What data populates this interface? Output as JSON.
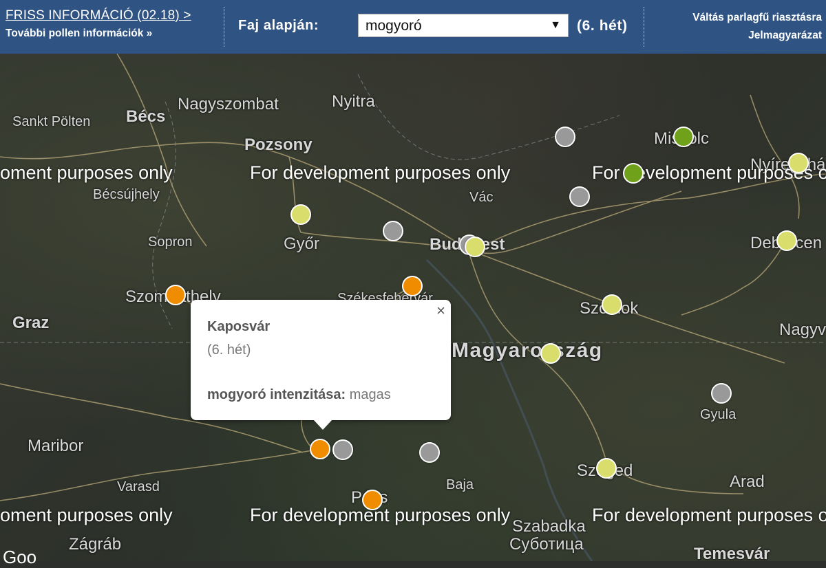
{
  "header": {
    "friss_link": "FRISS INFORMÁCIÓ (02.18) >",
    "more_link": "További pollen információk »",
    "faj_label": "Faj alapján:",
    "species_select": "mogyoró",
    "week": "(6. hét)",
    "switch_link": "Váltás parlagfű riasztásra",
    "legend_link": "Jelmagyarázat"
  },
  "map": {
    "watermark": "For development purposes only",
    "watermark_left": "oment purposes only",
    "watermark_right": "For development purposes o",
    "places": {
      "nagyszombat": "Nagyszombat",
      "nyitra": "Nyitra",
      "sankt_polten": "Sankt Pölten",
      "becs": "Bécs",
      "pozsony": "Pozsony",
      "miskolc": "Miskolc",
      "nyiregyhaza": "Nyíregyhá",
      "becsujhely": "Bécsújhely",
      "vac": "Vác",
      "gyor": "Győr",
      "sopron": "Sopron",
      "budapest": "Budapest",
      "debrecen": "Debrecen",
      "szombathely": "Szombathely",
      "szekesfehervar": "Székesfehérvár",
      "graz": "Graz",
      "szolnok": "Szolnok",
      "nagyvarad": "Nagyv",
      "magyarorszag": "Magyarország",
      "gyula": "Gyula",
      "maribor": "Maribor",
      "baja": "Baja",
      "szeged": "Szeged",
      "arad": "Arad",
      "varasd": "Varasd",
      "pecs": "Pécs",
      "szabadka": "Szabadka",
      "subotica": "Суботица",
      "zagrab": "Zágráb",
      "temesvar": "Temesvár"
    },
    "colors": {
      "gray": "#999999",
      "yellow": "#d9dd6b",
      "green": "#6fa11a",
      "orange": "#f08c00"
    }
  },
  "popup": {
    "close": "×",
    "city": "Kaposvár",
    "week": "(6. hét)",
    "intensity_label": "mogyoró intenzitása:",
    "intensity_value": "magas"
  },
  "footer": {
    "google": "Goo"
  }
}
